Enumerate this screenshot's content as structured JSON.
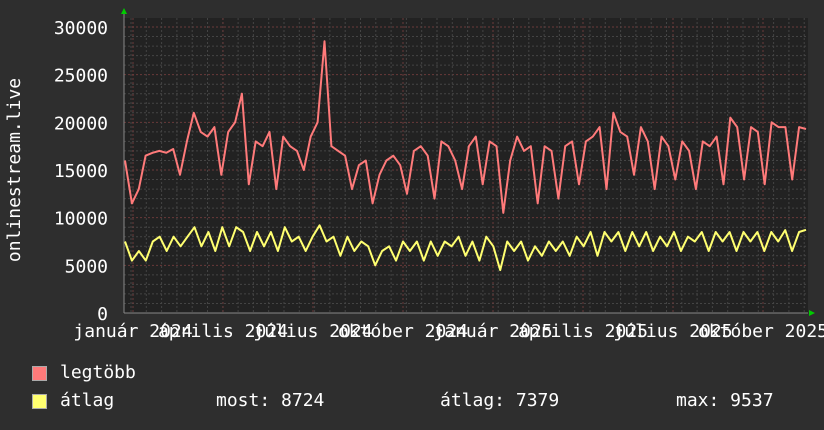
{
  "chart_data": {
    "type": "line",
    "ylabel": "onlinestream.live",
    "ylim": [
      0,
      30000
    ],
    "yticks": [
      "0",
      "5000",
      "10000",
      "15000",
      "20000",
      "25000",
      "30000"
    ],
    "xlim": [
      "2023-12-23",
      "2025-11-15"
    ],
    "xticks": [
      "január 2024",
      "április 2024",
      "július 2024",
      "október 2024",
      "január 2025",
      "április 2025",
      "július 2025",
      "október 2025"
    ],
    "grid": true,
    "legend_position": "bottom-left",
    "series": [
      {
        "name": "legtöbb",
        "color": "#ff7a7a",
        "values": [
          16000,
          11500,
          13000,
          16500,
          16800,
          17000,
          16800,
          17200,
          14500,
          18000,
          21000,
          19000,
          18500,
          19500,
          14500,
          19000,
          20000,
          23000,
          13500,
          18000,
          17500,
          19000,
          13000,
          18500,
          17500,
          17000,
          15000,
          18500,
          20000,
          28500,
          17500,
          17000,
          16500,
          13000,
          15500,
          16000,
          11500,
          14500,
          16000,
          16500,
          15500,
          12500,
          17000,
          17500,
          16500,
          12000,
          18000,
          17500,
          16000,
          13000,
          17500,
          18500,
          13500,
          18000,
          17500,
          10500,
          16000,
          18500,
          17000,
          17500,
          11500,
          17500,
          17000,
          12000,
          17500,
          18000,
          13500,
          18000,
          18500,
          19500,
          13000,
          21000,
          19000,
          18500,
          14500,
          19500,
          18000,
          13000,
          18500,
          17500,
          14000,
          18000,
          17000,
          13000,
          18000,
          17500,
          18500,
          13500,
          20500,
          19500,
          14000,
          19500,
          19000,
          13500,
          20000,
          19500,
          19500,
          14000,
          19500,
          19300
        ]
      },
      {
        "name": "átlag",
        "color": "#ffff70",
        "values": [
          7500,
          5500,
          6500,
          5500,
          7500,
          8000,
          6500,
          8000,
          7000,
          8000,
          9000,
          7000,
          8500,
          6500,
          9000,
          7000,
          9000,
          8500,
          6500,
          8500,
          7000,
          8500,
          6500,
          9000,
          7500,
          8000,
          6500,
          8000,
          9200,
          7500,
          8000,
          6000,
          8000,
          6500,
          7500,
          7000,
          5000,
          6500,
          7000,
          5500,
          7500,
          6500,
          7500,
          5500,
          7500,
          6000,
          7500,
          7000,
          8000,
          6000,
          7500,
          5500,
          8000,
          7000,
          4500,
          7500,
          6500,
          7500,
          5500,
          7000,
          6000,
          7500,
          6500,
          7500,
          6000,
          8000,
          7000,
          8500,
          6000,
          8500,
          7500,
          8500,
          6500,
          8500,
          7000,
          8500,
          6500,
          8000,
          7000,
          8500,
          6500,
          8000,
          7500,
          8500,
          6500,
          8500,
          7500,
          8500,
          6500,
          8500,
          7500,
          8500,
          6500,
          8500,
          7500,
          8700,
          6500,
          8500,
          8724
        ]
      }
    ]
  },
  "legend": {
    "items": [
      {
        "label": "legtöbb",
        "color": "#ff7a7a"
      },
      {
        "label": "átlag",
        "color": "#ffff70"
      }
    ],
    "stats": {
      "most": "most: 8724",
      "atlag": "átlag: 7379",
      "max": "max: 9537"
    }
  },
  "colors": {
    "background": "#2e2e2e",
    "plot": "#222222",
    "axis_arrow": "#00cc00"
  }
}
